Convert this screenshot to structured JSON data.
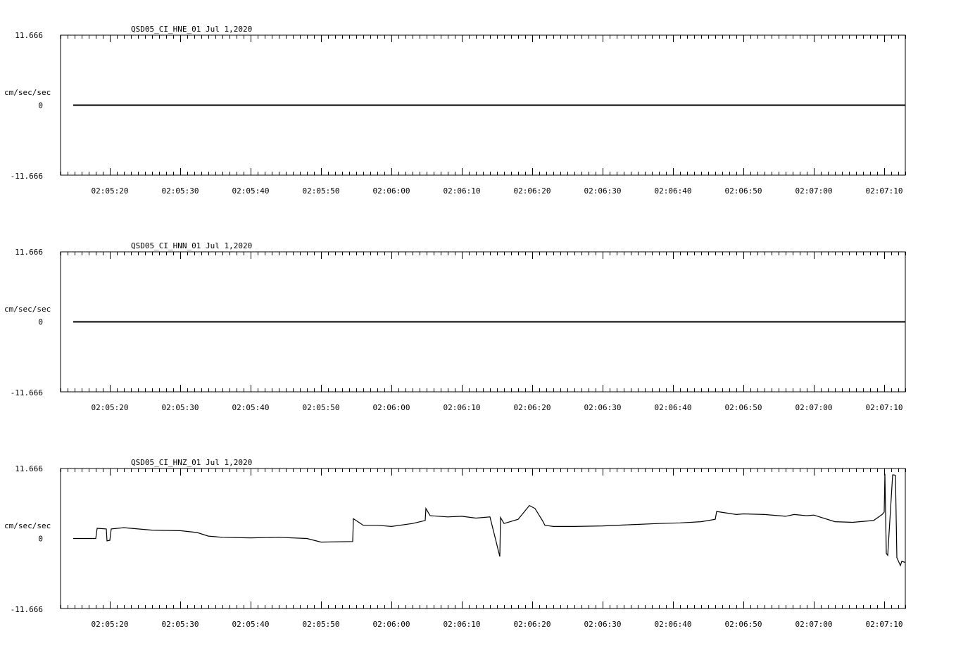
{
  "chart_data": [
    {
      "type": "line",
      "title": "QSD05_CI_HNE_01  Jul 1,2020",
      "ylabel": "cm/sec/sec",
      "ylim": [
        -11.666,
        11.666
      ],
      "y_ticks": [
        "11.666",
        "0",
        "-11.666"
      ],
      "xlim": [
        "02:05:13",
        "02:07:13"
      ],
      "x_ticks": [
        "02:05:20",
        "02:05:30",
        "02:05:40",
        "02:05:50",
        "02:06:00",
        "02:06:10",
        "02:06:20",
        "02:06:30",
        "02:06:40",
        "02:06:50",
        "02:07:00",
        "02:07:10"
      ],
      "series": [
        {
          "x": [
            "02:05:14.8",
            "02:07:13"
          ],
          "y": [
            0,
            0
          ]
        }
      ]
    },
    {
      "type": "line",
      "title": "QSD05_CI_HNN_01  Jul 1,2020",
      "ylabel": "cm/sec/sec",
      "ylim": [
        -11.666,
        11.666
      ],
      "y_ticks": [
        "11.666",
        "0",
        "-11.666"
      ],
      "xlim": [
        "02:05:13",
        "02:07:13"
      ],
      "x_ticks": [
        "02:05:20",
        "02:05:30",
        "02:05:40",
        "02:05:50",
        "02:06:00",
        "02:06:10",
        "02:06:20",
        "02:06:30",
        "02:06:40",
        "02:06:50",
        "02:07:00",
        "02:07:10"
      ],
      "series": [
        {
          "x": [
            "02:05:14.8",
            "02:07:13"
          ],
          "y": [
            0,
            0
          ]
        }
      ]
    },
    {
      "type": "line",
      "title": "QSD05_CI_HNZ_01  Jul 1,2020",
      "ylabel": "cm/sec/sec",
      "ylim": [
        -11.666,
        11.666
      ],
      "y_ticks": [
        "11.666",
        "0",
        "-11.666"
      ],
      "xlim": [
        "02:05:13",
        "02:07:13"
      ],
      "x_ticks": [
        "02:05:20",
        "02:05:30",
        "02:05:40",
        "02:05:50",
        "02:06:00",
        "02:06:10",
        "02:06:20",
        "02:06:30",
        "02:06:40",
        "02:06:50",
        "02:07:00",
        "02:07:10"
      ],
      "series": [
        {
          "x": [
            "02:05:14.8",
            "02:05:18.0",
            "02:05:18.2",
            "02:05:19.5",
            "02:05:19.6",
            "02:05:20.0",
            "02:05:20.2",
            "02:05:22.0",
            "02:05:26.0",
            "02:05:30.0",
            "02:05:32.4",
            "02:05:34.0",
            "02:05:36.0",
            "02:05:40.0",
            "02:05:44.0",
            "02:05:48.0",
            "02:05:50.0",
            "02:05:54.5",
            "02:05:54.6",
            "02:05:56.0",
            "02:05:58.0",
            "02:06:00.0",
            "02:06:03.0",
            "02:06:04.8",
            "02:06:04.9",
            "02:06:05.5",
            "02:06:08.0",
            "02:06:10.0",
            "02:06:12.0",
            "02:06:14.0",
            "02:06:15.4",
            "02:06:15.5",
            "02:06:15.6",
            "02:06:16.0",
            "02:06:18.0",
            "02:06:19.6",
            "02:06:20.4",
            "02:06:21.5",
            "02:06:21.8",
            "02:06:23.0",
            "02:06:26.0",
            "02:06:30.0",
            "02:06:34.0",
            "02:06:38.0",
            "02:06:41.0",
            "02:06:44.0",
            "02:06:46.0",
            "02:06:46.2",
            "02:06:49.0",
            "02:06:50.0",
            "02:06:53.0",
            "02:06:56.0",
            "02:06:57.2",
            "02:06:59.0",
            "02:07:00.0",
            "02:07:03.0",
            "02:07:05.5",
            "02:07:08.5",
            "02:07:09.7",
            "02:07:10.0",
            "02:07:10.1",
            "02:07:10.3",
            "02:07:10.5",
            "02:07:11.2",
            "02:07:11.4",
            "02:07:11.6",
            "02:07:11.8",
            "02:07:12.3",
            "02:07:12.5",
            "02:07:13.0"
          ],
          "y": [
            0.0,
            0.0,
            1.7,
            1.6,
            -0.4,
            -0.3,
            1.6,
            1.8,
            1.4,
            1.3,
            1.0,
            0.4,
            0.2,
            0.1,
            0.2,
            0.0,
            -0.6,
            -0.5,
            3.3,
            2.2,
            2.2,
            2.0,
            2.5,
            3.0,
            5.0,
            3.8,
            3.6,
            3.7,
            3.4,
            3.6,
            -3.0,
            3.5,
            3.3,
            2.5,
            3.2,
            5.5,
            5.0,
            2.9,
            2.2,
            2.0,
            2.0,
            2.1,
            2.3,
            2.5,
            2.6,
            2.8,
            3.2,
            4.5,
            4.0,
            4.1,
            4.0,
            3.7,
            4.0,
            3.8,
            3.9,
            2.8,
            2.7,
            3.0,
            4.0,
            4.4,
            10.8,
            -2.5,
            -2.8,
            10.6,
            10.6,
            10.5,
            -3.2,
            -4.5,
            -3.8,
            -4.0
          ]
        }
      ]
    }
  ]
}
